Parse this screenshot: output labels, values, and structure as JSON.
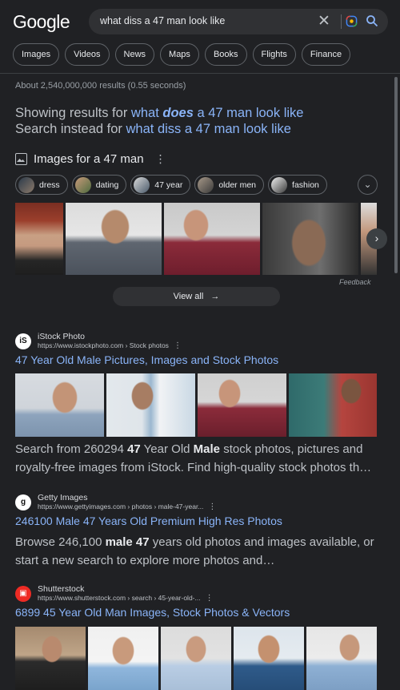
{
  "header": {
    "logo": "Google",
    "query": "what diss a 47 man look like",
    "tabs": [
      "Images",
      "Videos",
      "News",
      "Maps",
      "Books",
      "Flights",
      "Finance"
    ]
  },
  "stats": "About 2,540,000,000 results (0.55 seconds)",
  "spell": {
    "showing_prefix": "Showing results for",
    "corrected_a": "what ",
    "corrected_b": "does",
    "corrected_c": " a 47 man look like",
    "instead_prefix": "Search instead for",
    "original": "what diss a 47 man look like"
  },
  "images": {
    "heading": "Images for a 47 man",
    "facets": [
      "dress",
      "dating",
      "47 year",
      "older men",
      "fashion"
    ],
    "view_all": "View all",
    "feedback": "Feedback"
  },
  "results": [
    {
      "site": "iStock Photo",
      "url": "https://www.istockphoto.com › Stock photos",
      "title": "47 Year Old Male Pictures, Images and Stock Photos",
      "snippet_1": "Search from 260294 ",
      "snippet_b1": "47",
      "snippet_2": " Year Old ",
      "snippet_b2": "Male",
      "snippet_3": " stock photos, pictures and royalty-free images from iStock. Find high-quality stock photos th…"
    },
    {
      "site": "Getty Images",
      "url": "https://www.gettyimages.com › photos › male-47-year...",
      "title": "246100 Male 47 Years Old Premium High Res Photos",
      "snippet_1": "Browse 246,100 ",
      "snippet_b1": "male 47",
      "snippet_2": " years old photos and images available, or start a new search to explore more photos and…"
    },
    {
      "site": "Shutterstock",
      "url": "https://www.shutterstock.com › search › 45-year-old-...",
      "title": "6899 45 Year Old Man Images, Stock Photos & Vectors"
    }
  ],
  "icons": {
    "clear": "close-icon",
    "lens": "lens-icon",
    "search": "search-icon",
    "images": "image-icon",
    "more": "kebab-icon",
    "chevron": "chevron-down-icon",
    "arrow": "arrow-right-icon"
  },
  "colors": {
    "background": "#202124",
    "link": "#8ab4f8",
    "text": "#bdc1c6"
  }
}
